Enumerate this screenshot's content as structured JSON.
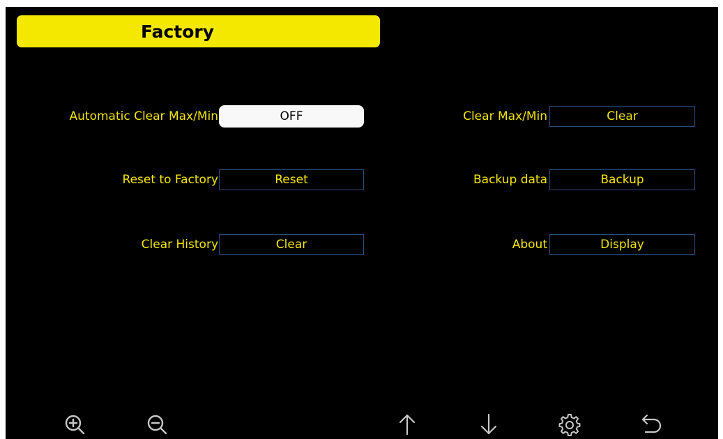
{
  "header": {
    "title": "Factory"
  },
  "settings": {
    "left": [
      {
        "label": "Automatic Clear Max/Min",
        "value": "OFF"
      },
      {
        "label": "Reset to Factory",
        "value": "Reset"
      },
      {
        "label": "Clear History",
        "value": "Clear"
      }
    ],
    "right": [
      {
        "label": "Clear Max/Min",
        "value": "Clear"
      },
      {
        "label": "Backup data",
        "value": "Backup"
      },
      {
        "label": "About",
        "value": "Display"
      }
    ]
  },
  "toolbar": {
    "icons": [
      "zoom-in-icon",
      "zoom-out-icon",
      "arrow-up-icon",
      "arrow-down-icon",
      "gear-icon",
      "back-icon"
    ]
  },
  "colors": {
    "background": "#000000",
    "accent_yellow": "#f4e800",
    "button_border": "#2a4a78",
    "active_button": "#f8f8f8",
    "icon": "#c8c8c8"
  }
}
